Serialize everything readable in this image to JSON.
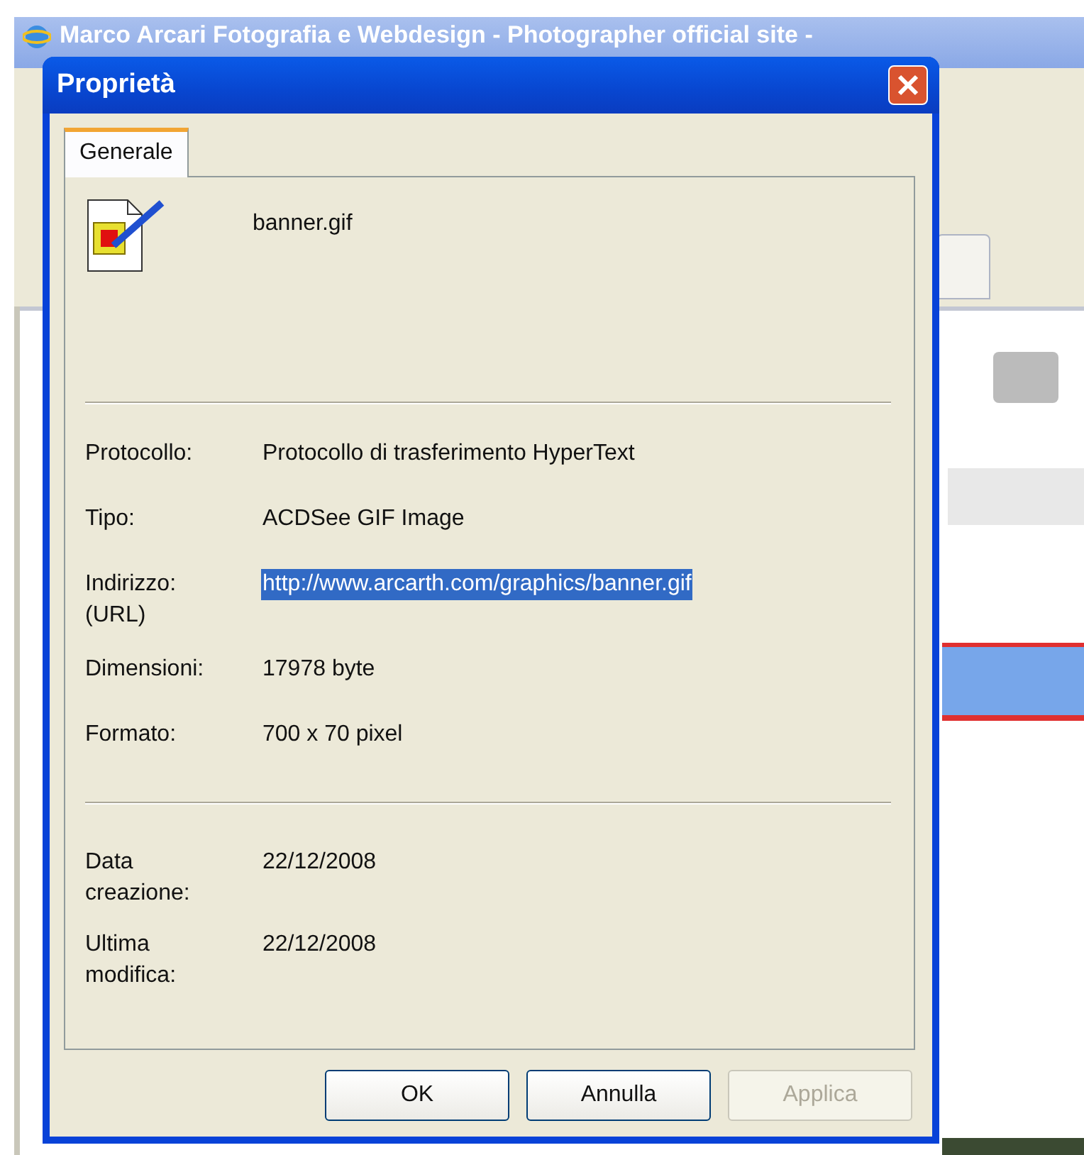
{
  "browser": {
    "title": "Marco Arcari Fotografia e Webdesign - Photographer official site -"
  },
  "dialog": {
    "title": "Proprietà",
    "tabs": [
      {
        "label": "Generale",
        "selected": true
      }
    ],
    "file_name": "banner.gif",
    "details": [
      {
        "label": "Protocollo:",
        "value": "Protocollo di trasferimento HyperText",
        "selected": false
      },
      {
        "label": "Tipo:",
        "value": "ACDSee GIF Image",
        "selected": false
      },
      {
        "label": "Indirizzo:\n(URL)",
        "value": "http://www.arcarth.com/graphics/banner.gif",
        "selected": true
      },
      {
        "label": "Dimensioni:",
        "value": "17978 byte",
        "selected": false
      },
      {
        "label": "Formato:",
        "value": "700 x 70 pixel",
        "selected": false
      }
    ],
    "dates": [
      {
        "label": "Data\ncreazione:",
        "value": "22/12/2008"
      },
      {
        "label": "Ultima\nmodifica:",
        "value": "22/12/2008"
      }
    ],
    "buttons": [
      {
        "label": "OK",
        "disabled": false
      },
      {
        "label": "Annulla",
        "disabled": false
      },
      {
        "label": "Applica",
        "disabled": true
      }
    ]
  }
}
